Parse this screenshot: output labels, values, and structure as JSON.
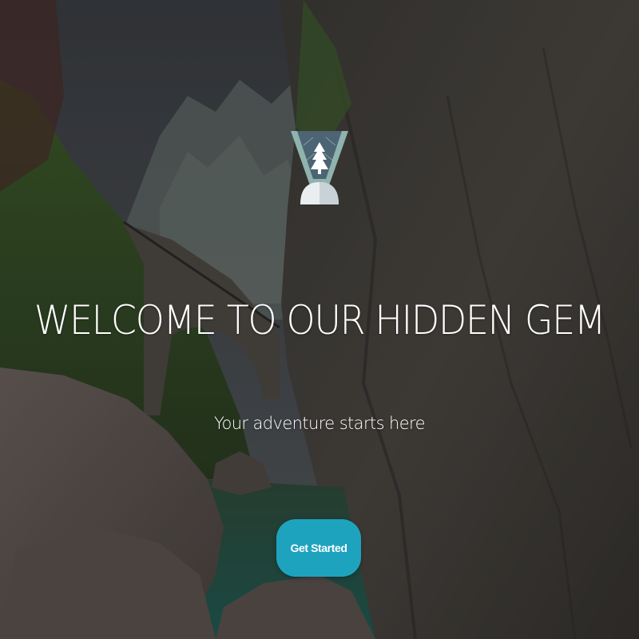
{
  "hero": {
    "title": "WELCOME TO OUR HIDDEN GEM",
    "subtitle": "Your adventure starts here",
    "cta_label": "Get Started"
  },
  "colors": {
    "cta_background": "#1ea3bf",
    "text": "#ffffff",
    "logo_teal": "#8fb3ad",
    "logo_slate": "#4c6473"
  },
  "icons": {
    "logo": "mountain-tree-logo-icon"
  }
}
